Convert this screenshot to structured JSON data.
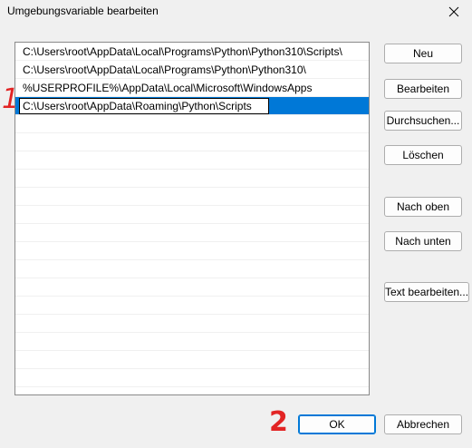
{
  "window": {
    "title": "Umgebungsvariable bearbeiten",
    "close_icon": "close-icon"
  },
  "list": {
    "items": [
      "C:\\Users\\root\\AppData\\Local\\Programs\\Python\\Python310\\Scripts\\",
      "C:\\Users\\root\\AppData\\Local\\Programs\\Python\\Python310\\",
      "%USERPROFILE%\\AppData\\Local\\Microsoft\\WindowsApps"
    ],
    "editing_value": "C:\\Users\\root\\AppData\\Roaming\\Python\\Scripts",
    "selection_color": "#0078d7"
  },
  "buttons": {
    "new": "Neu",
    "edit": "Bearbeiten",
    "browse": "Durchsuchen...",
    "delete": "Löschen",
    "move_up": "Nach oben",
    "move_down": "Nach unten",
    "edit_text": "Text bearbeiten...",
    "ok": "OK",
    "cancel": "Abbrechen"
  },
  "annotations": {
    "marker_1": "1",
    "marker_2": "2",
    "color": "#e22424"
  }
}
